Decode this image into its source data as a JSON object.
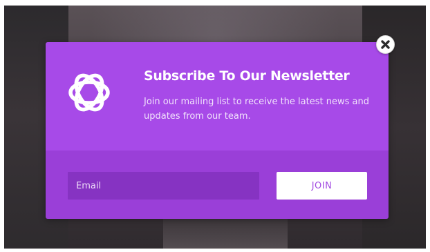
{
  "newsletter": {
    "title": "Subscribe To Our Newsletter",
    "subtitle": "Join our mailing list to receive the latest news and updates from our team.",
    "email_placeholder": "Email",
    "email_value": "",
    "join_label": "JOIN"
  },
  "icons": {
    "logo": "flower-logo-icon",
    "close": "close-icon"
  },
  "colors": {
    "accent": "#a74ae8",
    "accent_dark": "#9a3fd8",
    "input_bg": "#8633c2",
    "button_text": "#a24be2",
    "backdrop": "#3a3538"
  }
}
